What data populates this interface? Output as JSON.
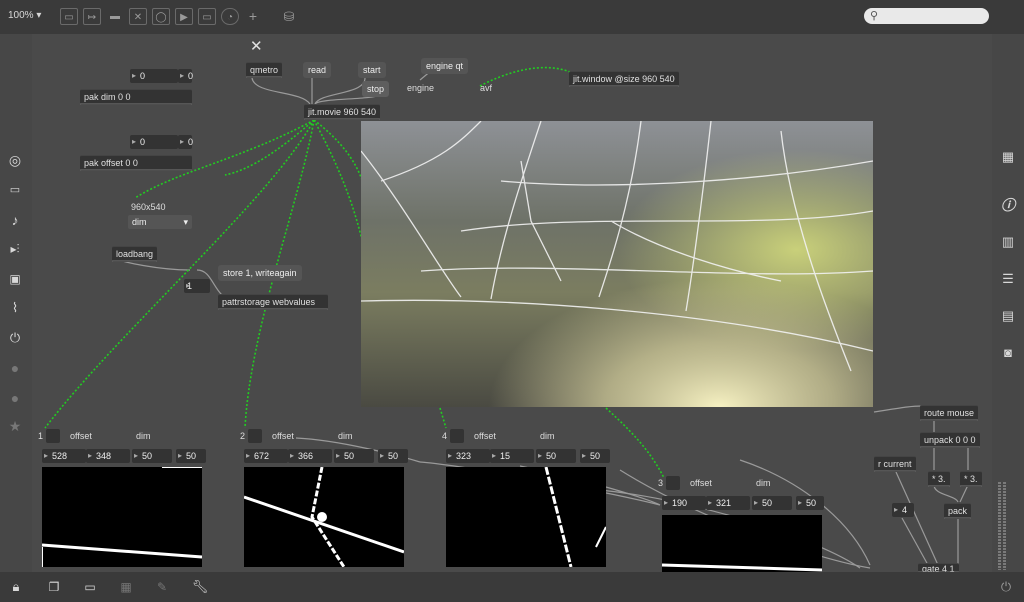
{
  "toolbar": {
    "zoom": "100%",
    "icons": [
      "new-object-icon",
      "message-icon",
      "comment-icon",
      "toggle-icon",
      "button-icon",
      "play-icon",
      "slider-icon",
      "dial-icon",
      "add-icon",
      "paint-bucket-icon"
    ]
  },
  "objects": {
    "qmetro": "qmetro",
    "read": "read",
    "start": "start",
    "stop": "stop",
    "engine_qt": "engine qt",
    "engine": "engine",
    "avf": "avf",
    "jit_window": "jit.window @size 960 540",
    "jit_movie": "jit.movie 960 540",
    "pak_dim": "pak dim 0 0",
    "pak_offset": "pak offset 0 0",
    "size_label": "960x540",
    "dim_menu": "dim",
    "loadbang": "loadbang",
    "store_msg": "store 1, writeagain",
    "store_num": "1",
    "pattrstorage": "pattrstorage webvalues",
    "route_mouse": "route mouse",
    "unpack": "unpack 0 0 0",
    "mul1": "* 3.",
    "mul2": "* 3.",
    "pack": "pack",
    "r_current": "r current",
    "gate": "gate 4 1",
    "gate_num": "4",
    "pak_dim_a": "0",
    "pak_dim_b": "0",
    "pak_off_a": "0",
    "pak_off_b": "0"
  },
  "tiles": [
    {
      "index": "1",
      "offset_label": "offset",
      "dim_label": "dim",
      "values": [
        "528",
        "348",
        "50",
        "50"
      ]
    },
    {
      "index": "2",
      "offset_label": "offset",
      "dim_label": "dim",
      "values": [
        "672",
        "366",
        "50",
        "50"
      ]
    },
    {
      "index": "4",
      "offset_label": "offset",
      "dim_label": "dim",
      "values": [
        "323",
        "15",
        "50",
        "50"
      ]
    },
    {
      "index": "3",
      "offset_label": "offset",
      "dim_label": "dim",
      "values": [
        "190",
        "321",
        "50",
        "50"
      ]
    }
  ],
  "colors": {
    "accent": "#22cc22",
    "background": "#4a4a4a",
    "box": "#333333"
  }
}
